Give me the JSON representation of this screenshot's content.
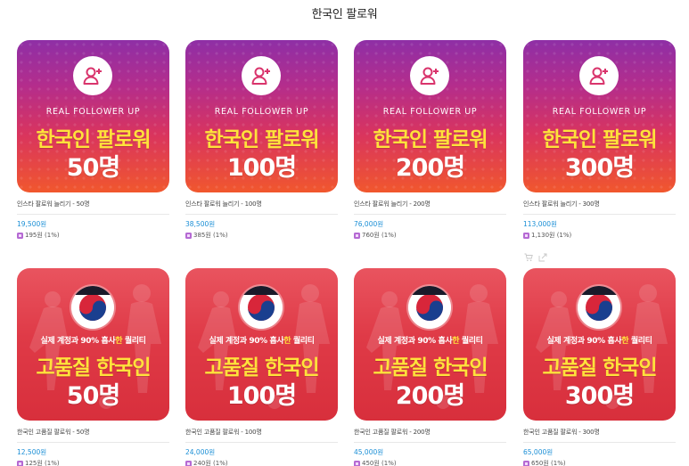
{
  "page": {
    "title": "한국인 팔로워"
  },
  "products": [
    {
      "style": "insta",
      "thumb": {
        "tagline": "REAL FOLLOWER UP",
        "line1": "한국인 팔로워",
        "line2": "50명"
      },
      "name": "인스타 팔로워 늘리기 - 50명",
      "price": "19,500원",
      "points": "195원 (1%)"
    },
    {
      "style": "insta",
      "thumb": {
        "tagline": "REAL FOLLOWER UP",
        "line1": "한국인 팔로워",
        "line2": "100명"
      },
      "name": "인스타 팔로워 늘리기 - 100명",
      "price": "38,500원",
      "points": "385원 (1%)"
    },
    {
      "style": "insta",
      "thumb": {
        "tagline": "REAL FOLLOWER UP",
        "line1": "한국인 팔로워",
        "line2": "200명"
      },
      "name": "인스타 팔로워 늘리기 - 200명",
      "price": "76,000원",
      "points": "760원 (1%)"
    },
    {
      "style": "insta",
      "thumb": {
        "tagline": "REAL FOLLOWER UP",
        "line1": "한국인 팔로워",
        "line2": "300명"
      },
      "name": "인스타 팔로워 늘리기 - 300명",
      "price": "113,000원",
      "points": "1,130원 (1%)"
    },
    {
      "style": "kr",
      "thumb": {
        "quality_pre": "실제 계정과 90% 흡사",
        "quality_hl": "한",
        "quality_post": " 퀄리티",
        "line1": "고품질 한국인",
        "line2": "50명"
      },
      "name": "한국인 고품질 팔로워 - 50명",
      "price": "12,500원",
      "points": "125원 (1%)"
    },
    {
      "style": "kr",
      "thumb": {
        "quality_pre": "실제 계정과 90% 흡사",
        "quality_hl": "한",
        "quality_post": " 퀄리티",
        "line1": "고품질 한국인",
        "line2": "100명"
      },
      "name": "한국인 고품질 팔로워 - 100명",
      "price": "24,000원",
      "points": "240원 (1%)"
    },
    {
      "style": "kr",
      "thumb": {
        "quality_pre": "실제 계정과 90% 흡사",
        "quality_hl": "한",
        "quality_post": " 퀄리티",
        "line1": "고품질 한국인",
        "line2": "200명"
      },
      "name": "한국인 고품질 팔로워 - 200명",
      "price": "45,000원",
      "points": "450원 (1%)"
    },
    {
      "style": "kr",
      "thumb": {
        "quality_pre": "실제 계정과 90% 흡사",
        "quality_hl": "한",
        "quality_post": " 퀄리티",
        "line1": "고품질 한국인",
        "line2": "300명"
      },
      "name": "한국인 고품질 팔로워 - 300명",
      "price": "65,000원",
      "points": "650원 (1%)"
    }
  ],
  "hover_icons": [
    "cart-icon",
    "share-icon"
  ],
  "colors": {
    "price": "#1b8fd6",
    "headline_yellow": "#ffe23b",
    "insta_top": "#8e2fa6",
    "insta_bottom": "#f1572d",
    "kr_red": "#df3a47",
    "point_icon": "#b56ad3"
  }
}
